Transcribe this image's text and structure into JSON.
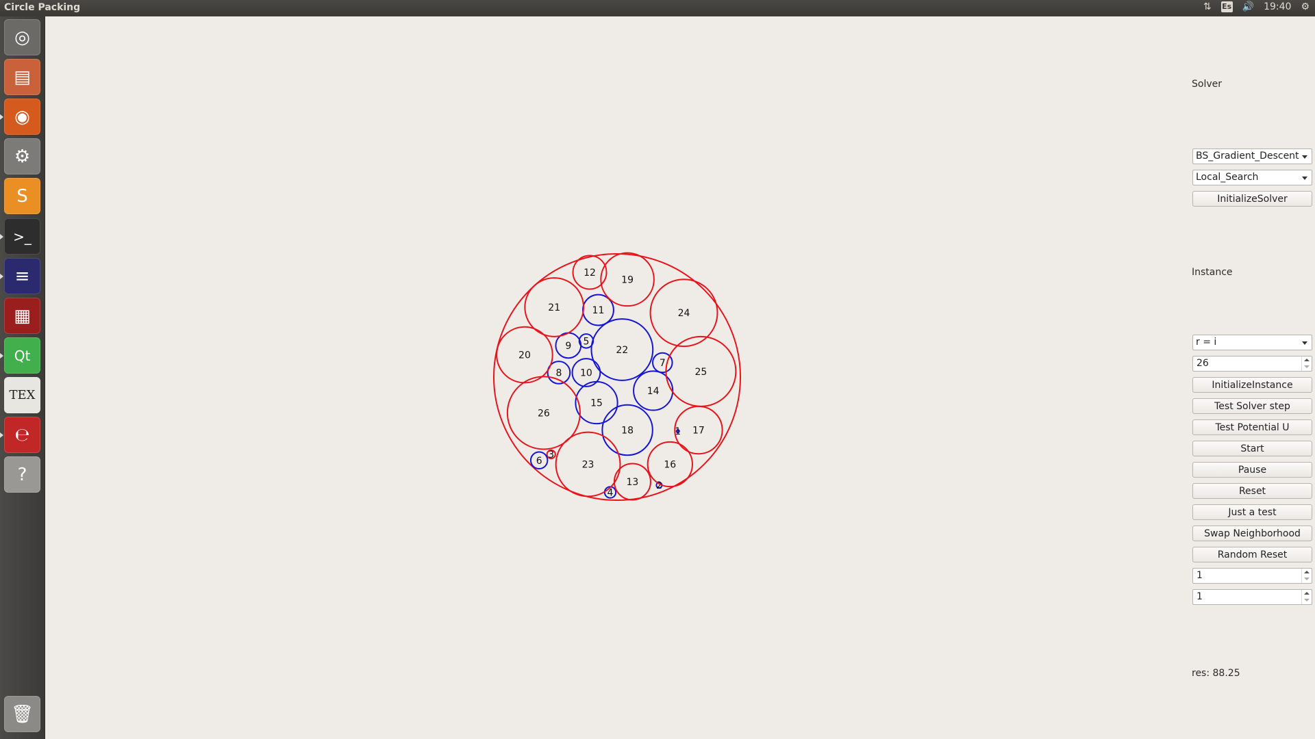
{
  "window": {
    "title": "Circle Packing"
  },
  "tray": {
    "keyboard": "Es",
    "time": "19:40",
    "icons": [
      "network-updown-icon",
      "keyboard-layout-icon",
      "volume-icon",
      "gear-icon"
    ]
  },
  "launcher": {
    "items": [
      {
        "name": "ubuntu-dash",
        "glyph": "◎",
        "color": "#6c6a66"
      },
      {
        "name": "files",
        "glyph": "▤",
        "color": "#c9623a"
      },
      {
        "name": "firefox",
        "glyph": "◉",
        "color": "#d45a1e"
      },
      {
        "name": "system-settings",
        "glyph": "⚙",
        "color": "#7d7b78"
      },
      {
        "name": "sublime-text",
        "glyph": "S",
        "color": "#e98f24"
      },
      {
        "name": "terminal",
        "glyph": ">_",
        "color": "#2d2d2d"
      },
      {
        "name": "eclipse",
        "glyph": "≡",
        "color": "#2c2a6e"
      },
      {
        "name": "app-red",
        "glyph": "▦",
        "color": "#9a1e1e"
      },
      {
        "name": "qt-creator",
        "glyph": "Qt",
        "color": "#41b04c"
      },
      {
        "name": "texmaker",
        "glyph": "TEX",
        "color": "#e8e6e0"
      },
      {
        "name": "document-viewer",
        "glyph": "℮",
        "color": "#c12727"
      },
      {
        "name": "help",
        "glyph": "?",
        "color": "#9a9895"
      },
      {
        "name": "trash",
        "glyph": "🗑",
        "color": "#8b8a86"
      }
    ]
  },
  "panel": {
    "solver_label": "Solver",
    "solver_combo1": "BS_Gradient_Descent",
    "solver_combo2": "Local_Search",
    "init_solver": "InitializeSolver",
    "instance_label": "Instance",
    "instance_combo": "r = i",
    "instance_count": "26",
    "init_instance": "InitializeInstance",
    "test_solver_step": "Test Solver step",
    "test_potential": "Test Potential U",
    "start": "Start",
    "pause": "Pause",
    "reset": "Reset",
    "just_a_test": "Just a test",
    "swap_neighborhood": "Swap Neighborhood",
    "random_reset": "Random Reset",
    "spin1": "1",
    "spin2": "1",
    "result": "res: 88.25"
  },
  "colors": {
    "red": "#e8141b",
    "blue": "#1515d2"
  },
  "packing": {
    "container": {
      "x": 0,
      "y": 0,
      "r": 88.25
    },
    "circles": [
      {
        "id": "1",
        "x": 43.5,
        "y": -38.8,
        "r": 1,
        "color": "blue"
      },
      {
        "id": "2",
        "x": 30.1,
        "y": -77.5,
        "r": 2,
        "color": "blue"
      },
      {
        "id": "3",
        "x": -47.2,
        "y": -55.4,
        "r": 3,
        "color": "red"
      },
      {
        "id": "4",
        "x": -4.9,
        "y": -82.6,
        "r": 4,
        "color": "blue"
      },
      {
        "id": "5",
        "x": -22.1,
        "y": 25.8,
        "r": 5,
        "color": "blue"
      },
      {
        "id": "6",
        "x": -55.8,
        "y": -59.7,
        "r": 6,
        "color": "blue"
      },
      {
        "id": "7",
        "x": 32.5,
        "y": 10.3,
        "r": 7,
        "color": "blue"
      },
      {
        "id": "8",
        "x": -41.7,
        "y": 3.2,
        "r": 8,
        "color": "blue"
      },
      {
        "id": "9",
        "x": -34.9,
        "y": 22.6,
        "r": 9,
        "color": "blue"
      },
      {
        "id": "10",
        "x": -22.1,
        "y": 3.2,
        "r": 10,
        "color": "blue"
      },
      {
        "id": "11",
        "x": -13.5,
        "y": 48.0,
        "r": 11,
        "color": "blue"
      },
      {
        "id": "12",
        "x": -19.6,
        "y": 75.0,
        "r": 12,
        "color": "red"
      },
      {
        "id": "13",
        "x": 11.0,
        "y": -75.0,
        "r": 13,
        "color": "red"
      },
      {
        "id": "14",
        "x": 25.8,
        "y": -9.8,
        "r": 14,
        "color": "blue"
      },
      {
        "id": "15",
        "x": -14.7,
        "y": -18.4,
        "r": 15,
        "color": "blue"
      },
      {
        "id": "16",
        "x": 37.9,
        "y": -62.5,
        "r": 16,
        "color": "red"
      },
      {
        "id": "17",
        "x": 58.3,
        "y": -38.0,
        "r": 17,
        "color": "red"
      },
      {
        "id": "18",
        "x": 7.4,
        "y": -38.0,
        "r": 18,
        "color": "blue"
      },
      {
        "id": "19",
        "x": 7.4,
        "y": 69.9,
        "r": 19,
        "color": "red"
      },
      {
        "id": "20",
        "x": -66.2,
        "y": 15.9,
        "r": 20,
        "color": "red"
      },
      {
        "id": "21",
        "x": -45.0,
        "y": 50.0,
        "r": 21,
        "color": "red"
      },
      {
        "id": "22",
        "x": 3.6,
        "y": 19.6,
        "r": 22,
        "color": "blue"
      },
      {
        "id": "23",
        "x": -20.8,
        "y": -62.5,
        "r": 23,
        "color": "red"
      },
      {
        "id": "24",
        "x": 47.8,
        "y": 46.0,
        "r": 24,
        "color": "red"
      },
      {
        "id": "25",
        "x": 60.0,
        "y": 4.0,
        "r": 25,
        "color": "red"
      },
      {
        "id": "26",
        "x": -52.5,
        "y": -25.7,
        "r": 26,
        "color": "red"
      }
    ]
  }
}
